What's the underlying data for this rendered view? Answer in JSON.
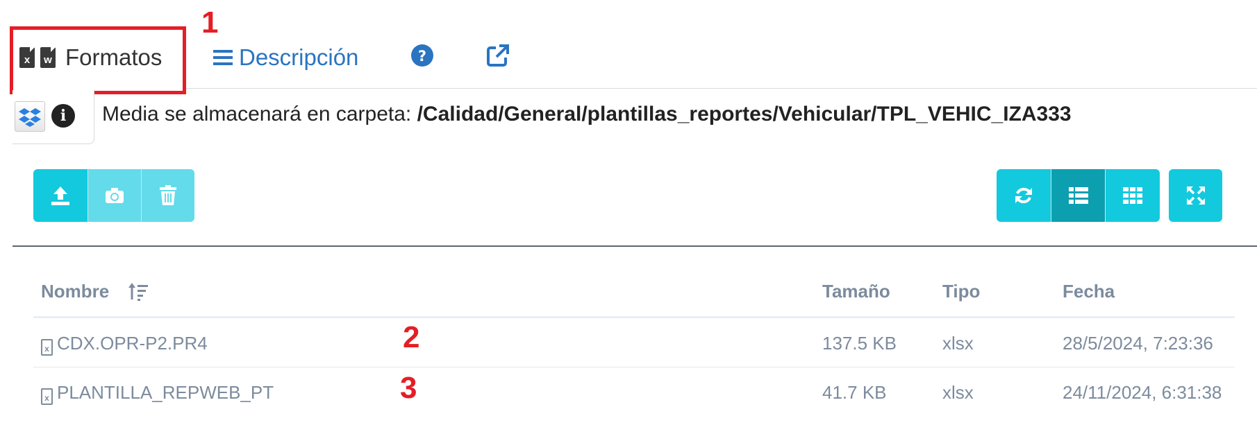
{
  "tabs": {
    "formatos_label": "Formatos",
    "formatos_icons": [
      "x",
      "w"
    ],
    "descripcion_label": "Descripción"
  },
  "annotations": [
    "1",
    "2",
    "3"
  ],
  "media": {
    "prefix": "Media se almacenará en carpeta: ",
    "path": "/Calidad/General/plantillas_reportes/Vehicular/TPL_VEHIC_IZA333"
  },
  "table": {
    "headers": {
      "name": "Nombre",
      "size": "Tamaño",
      "type": "Tipo",
      "date": "Fecha"
    },
    "rows": [
      {
        "icon": "x",
        "name": "CDX.OPR-P2.PR4",
        "size": "137.5 KB",
        "type": "xlsx",
        "date": "28/5/2024, 7:23:36"
      },
      {
        "icon": "x",
        "name": "PLANTILLA_REPWEB_PT",
        "size": "41.7 KB",
        "type": "xlsx",
        "date": "24/11/2024, 6:31:38"
      }
    ]
  },
  "colors": {
    "accent": "#13c9de",
    "active": "#0c9fb0",
    "disabled": "#63dbea",
    "link": "#2a74c0",
    "annotation": "#e41e26"
  },
  "icons": [
    "excel-file-icon",
    "word-file-icon",
    "list-icon",
    "help-icon",
    "external-link-icon",
    "dropbox-icon",
    "info-icon",
    "upload-icon",
    "camera-icon",
    "trash-icon",
    "refresh-icon",
    "list-view-icon",
    "grid-view-icon",
    "fullscreen-icon",
    "sort-icon"
  ]
}
